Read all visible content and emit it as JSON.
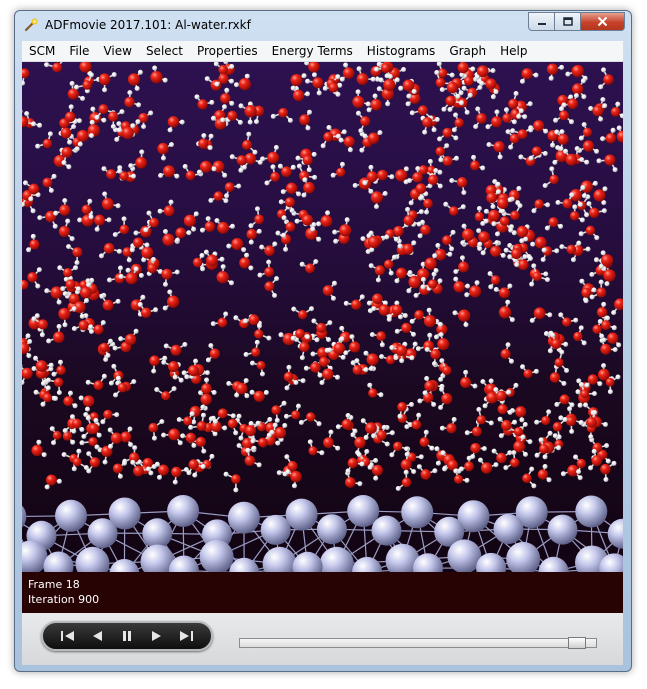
{
  "window": {
    "title": "ADFmovie 2017.101: Al-water.rxkf",
    "app_icon": "wand-icon",
    "controls": [
      "minimize-icon",
      "maximize-icon",
      "close-icon"
    ]
  },
  "menubar": {
    "items": [
      {
        "label": "SCM"
      },
      {
        "label": "File"
      },
      {
        "label": "View"
      },
      {
        "label": "Select"
      },
      {
        "label": "Properties"
      },
      {
        "label": "Energy Terms"
      },
      {
        "label": "Histograms"
      },
      {
        "label": "Graph"
      },
      {
        "label": "Help"
      }
    ]
  },
  "viewport": {
    "content": "molecular-scene",
    "colors": {
      "oxygen": "#e11a10",
      "hydrogen": "#f2f2f2",
      "aluminum": "#b7bbe0",
      "background_top": "#2d1150",
      "background_bottom": "#120412"
    }
  },
  "status": {
    "frame": "Frame 18",
    "iteration": "Iteration 900"
  },
  "playback": {
    "buttons": [
      "skip-to-start-icon",
      "step-back-icon",
      "pause-icon",
      "step-forward-icon",
      "skip-to-end-icon"
    ],
    "progress": 0.97
  }
}
